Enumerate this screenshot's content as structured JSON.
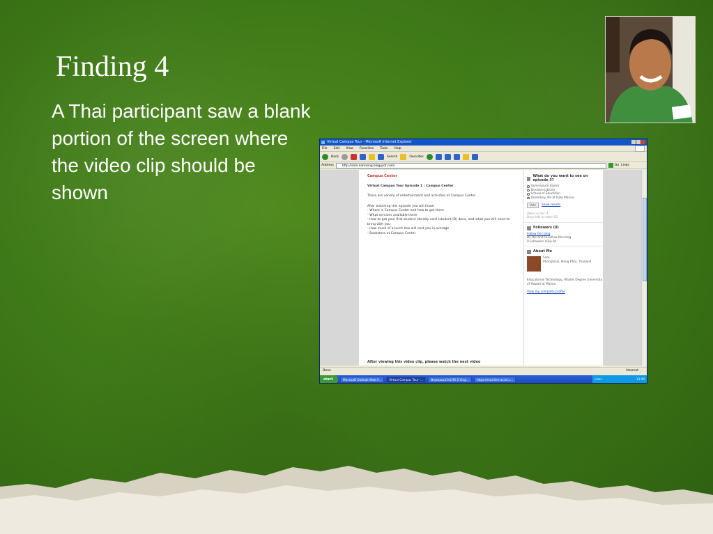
{
  "slide": {
    "title": "Finding 4",
    "body": "A Thai participant saw a blank portion of the screen where the video clip should be shown",
    "photo_label": "participant photo"
  },
  "browser": {
    "window_title": "Virtual Campus Tour - Microsoft Internet Explorer",
    "menu": [
      "File",
      "Edit",
      "View",
      "Favorites",
      "Tools",
      "Help"
    ],
    "toolbar": {
      "back": "Back",
      "search": "Search",
      "favorites": "Favorites"
    },
    "address_label": "Address",
    "address_value": "http://sam-namsong.blogspot.com/",
    "go_label": "Go",
    "links_label": "Links",
    "status_text": "Done",
    "status_zone": "Internet"
  },
  "blog": {
    "section_heading": "Campus Center",
    "post_title": "Virtual Campus Tour Episode 1 : Campus Center",
    "intro": "There are variety of entertainment and activities at Campus Center",
    "list_intro": "After watching this episode you will know:",
    "list": [
      "- Where is Campus Center and how to get there",
      "- What services available there",
      "- How to get your first student identity card (student ID) done, and what you will need to bring with you",
      "- How much of a lunch box will cost you in average",
      "- Bookstore at Campus Center"
    ],
    "footer": "After viewing this video clip, please watch the next video"
  },
  "sidebar": {
    "poll_question": "What do you want to see on episode 3?",
    "poll_options": [
      "Gymnasium (Gym)",
      "Sinclaire Library",
      "School of Education",
      "Dormitory life at Hale Manoa"
    ],
    "vote_button": "Vote",
    "show_results": "Show results",
    "votes_so_far": "Votes so far: 4",
    "days_left": "Days left to vote: 63",
    "followers_heading": "Followers (0)",
    "follow_link": "Follow this blog",
    "be_first": "Be the first to follow this blog",
    "followers_view": "0 Followers View All",
    "about_heading": "About Me",
    "about_name": "Sam",
    "about_location": "Phonphisai, Nong Khai, Thailand",
    "about_desc": "Educational Technology, Master Degree University of Hawaii at Manoa",
    "profile_link": "View my complete profile"
  },
  "taskbar": {
    "start": "start",
    "items": [
      "Microsoft Outlook Web A...",
      "Virtual Campus Tour -...",
      "ฟังเพลงออนไลน์ 95.5 Virgi...",
      "https://mail.the-accel.c..."
    ],
    "tray_links": "Links",
    "time": "13:49"
  }
}
